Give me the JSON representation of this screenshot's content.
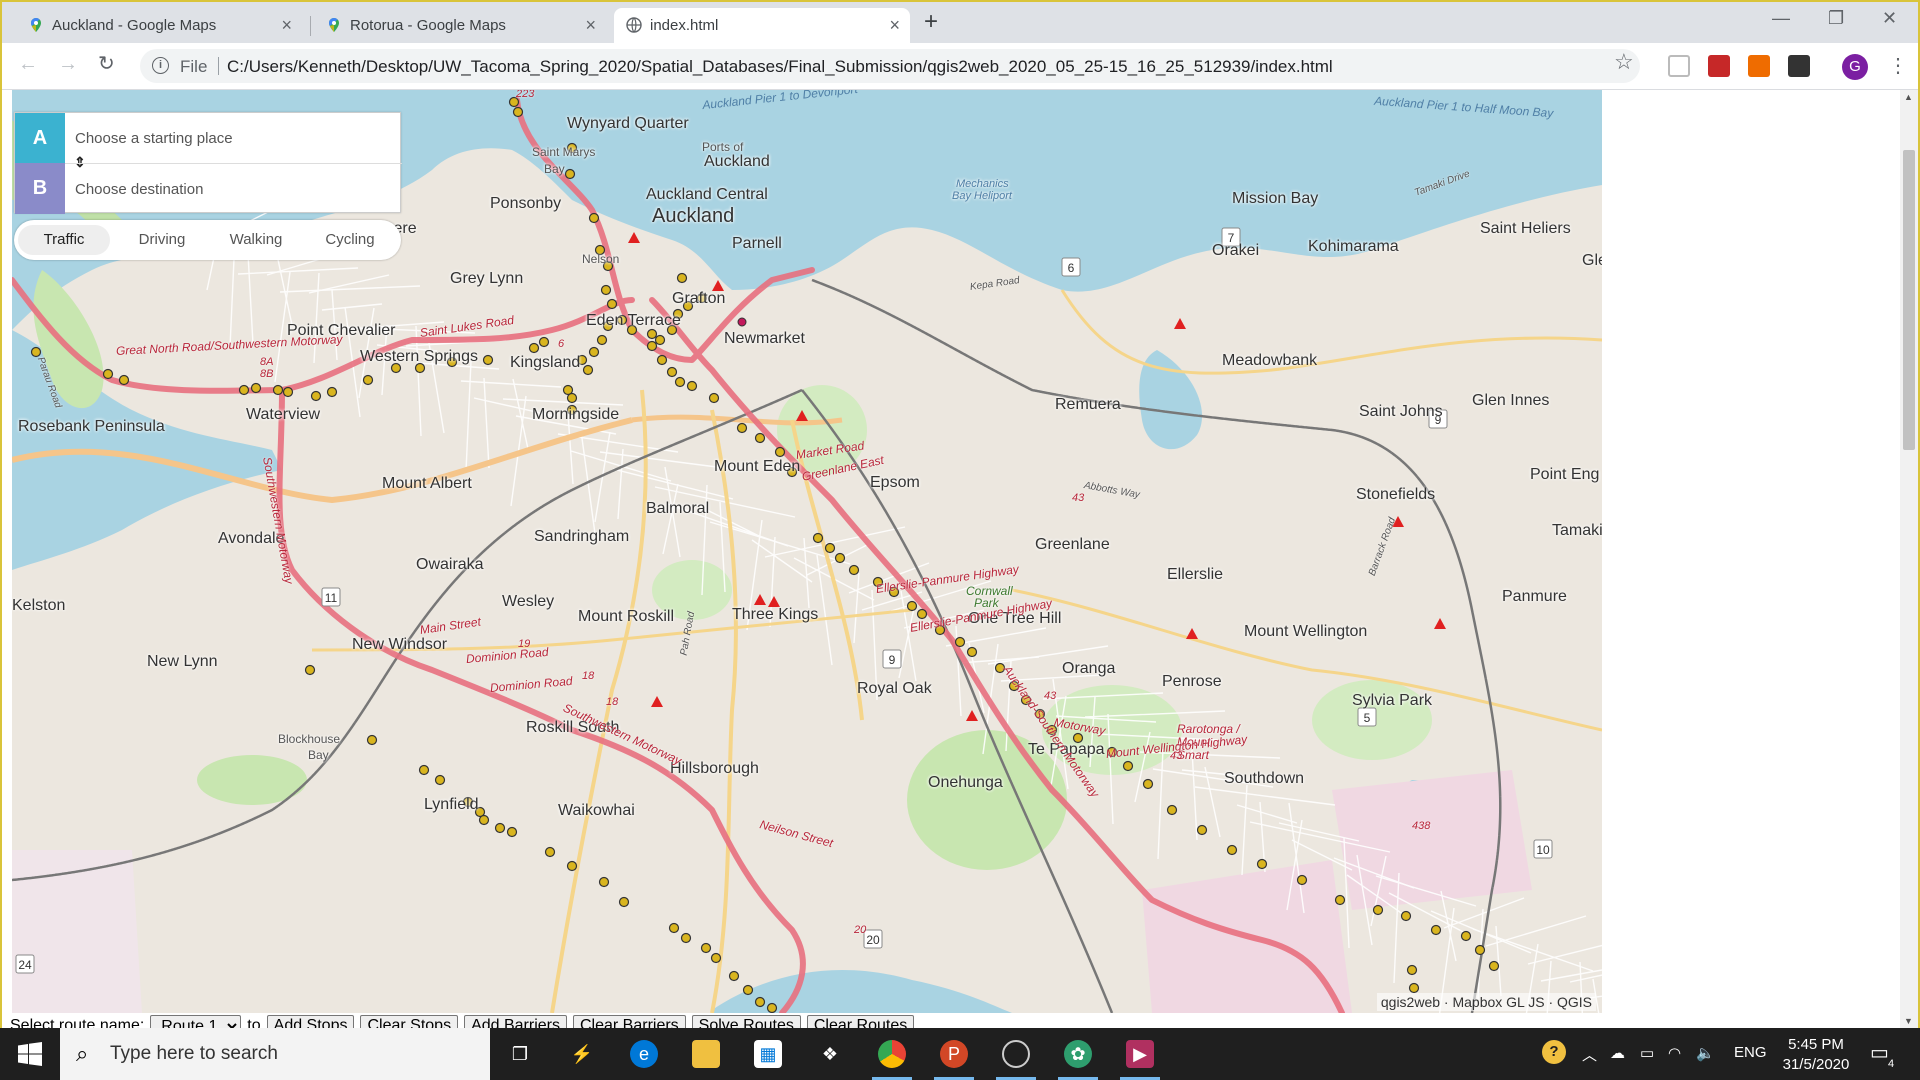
{
  "browser": {
    "tabs": [
      {
        "title": "Auckland - Google Maps",
        "icon": "google-maps-pin-icon",
        "active": false
      },
      {
        "title": "Rotorua - Google Maps",
        "icon": "google-maps-pin-icon",
        "active": false
      },
      {
        "title": "index.html",
        "icon": "globe-icon",
        "active": true
      }
    ],
    "address_scheme": "File",
    "url": "C:/Users/Kenneth/Desktop/UW_Tacoma_Spring_2020/Spatial_Databases/Final_Submission/qgis2web_2020_05_25-15_16_25_512939/index.html",
    "profile_initial": "G"
  },
  "directions": {
    "origin_letter": "A",
    "destination_letter": "B",
    "origin_placeholder": "Choose a starting place",
    "destination_placeholder": "Choose destination",
    "profiles": [
      "Traffic",
      "Driving",
      "Walking",
      "Cycling"
    ],
    "selected_profile": "Traffic"
  },
  "map": {
    "place_labels": [
      "Wynyard Quarter",
      "Saint Marys",
      "Bay",
      "Ports of",
      "Auckland",
      "Auckland Central",
      "Auckland",
      "Ponsonby",
      "Westmere",
      "Parnell",
      "Mission Bay",
      "Saint Heliers",
      "Kohimarama",
      "Orakei",
      "Grey Lynn",
      "Nelson",
      "Grafton",
      "Eden Terrace",
      "Newmarket",
      "Point Chevalier",
      "Western Springs",
      "Kingsland",
      "Meadowbank",
      "Glen Innes",
      "Remuera",
      "Saint Johns",
      "Rosebank Peninsula",
      "Waterview",
      "Morningside",
      "Mount Eden",
      "Epsom",
      "Point Eng",
      "Mount Albert",
      "Stonefields",
      "Balmoral",
      "Sandringham",
      "Greenlane",
      "Tamaki",
      "Avondale",
      "Owairaka",
      "Ellerslie",
      "Kelston",
      "Wesley",
      "Mount Roskill",
      "Three Kings",
      "One Tree Hill",
      "Panmure",
      "Mount Wellington",
      "New Windsor",
      "New Lynn",
      "Oranga",
      "Penrose",
      "Royal Oak",
      "Sylvia Park",
      "Roskill South",
      "Blockhouse",
      "Bay",
      "Rarotonga /",
      "Mount",
      "Smart",
      "Te Papapa",
      "Hillsborough",
      "Onehunga",
      "Southdown",
      "Lynfield",
      "Waikowhai",
      "Cornwall",
      "Park",
      "Gle",
      "Mechanics",
      "Bay Heliport"
    ],
    "road_labels": [
      "Great North Road/Southwestern Motorway",
      "Saint Lukes Road",
      "Market Road",
      "Greenlane East",
      "Ellerslie-Panmure Highway",
      "Ellerslie-Panmure Highway",
      "Mount Wellington Highway",
      "Main Street",
      "Dominion Road",
      "Dominion Road",
      "Southwestern Motorway",
      "Neilson Street",
      "Auckland-Southern Motorway",
      "Kepa Road",
      "Abbotts Way",
      "Tamaki Drive",
      "Barrack Road",
      "Pah Road",
      "Southwestern Motorway",
      "Motorway",
      "Parau Road"
    ],
    "water_labels": [
      "Auckland Pier 1 to Devonport",
      "Auckland Pier 1 to Half Moon Bay"
    ],
    "highway_shields": [
      "6",
      "7",
      "9",
      "9",
      "5",
      "10",
      "11",
      "24",
      "20"
    ],
    "route_numbers": [
      "223",
      "8A",
      "8B",
      "6",
      "19",
      "18",
      "18",
      "43",
      "43",
      "43",
      "438",
      "20"
    ],
    "attribution": "qgis2web · Mapbox GL JS · QGIS",
    "colors": {
      "route": "#e8707f",
      "stop_fill": "#d9b51f",
      "stop_stroke": "#333333",
      "water": "#a9d3e2",
      "marker_triangle": "#e02020"
    }
  },
  "route_controls": {
    "select_label": "Select route name:",
    "selected_route": "Route 1",
    "to_label": "to",
    "buttons": [
      "Add Stops",
      "Clear Stops",
      "Add Barriers",
      "Clear Barriers",
      "Solve Routes",
      "Clear Routes"
    ]
  },
  "taskbar": {
    "search_placeholder": "Type here to search",
    "language": "ENG",
    "time": "5:45 PM",
    "date": "31/5/2020",
    "notification_count": "4"
  }
}
